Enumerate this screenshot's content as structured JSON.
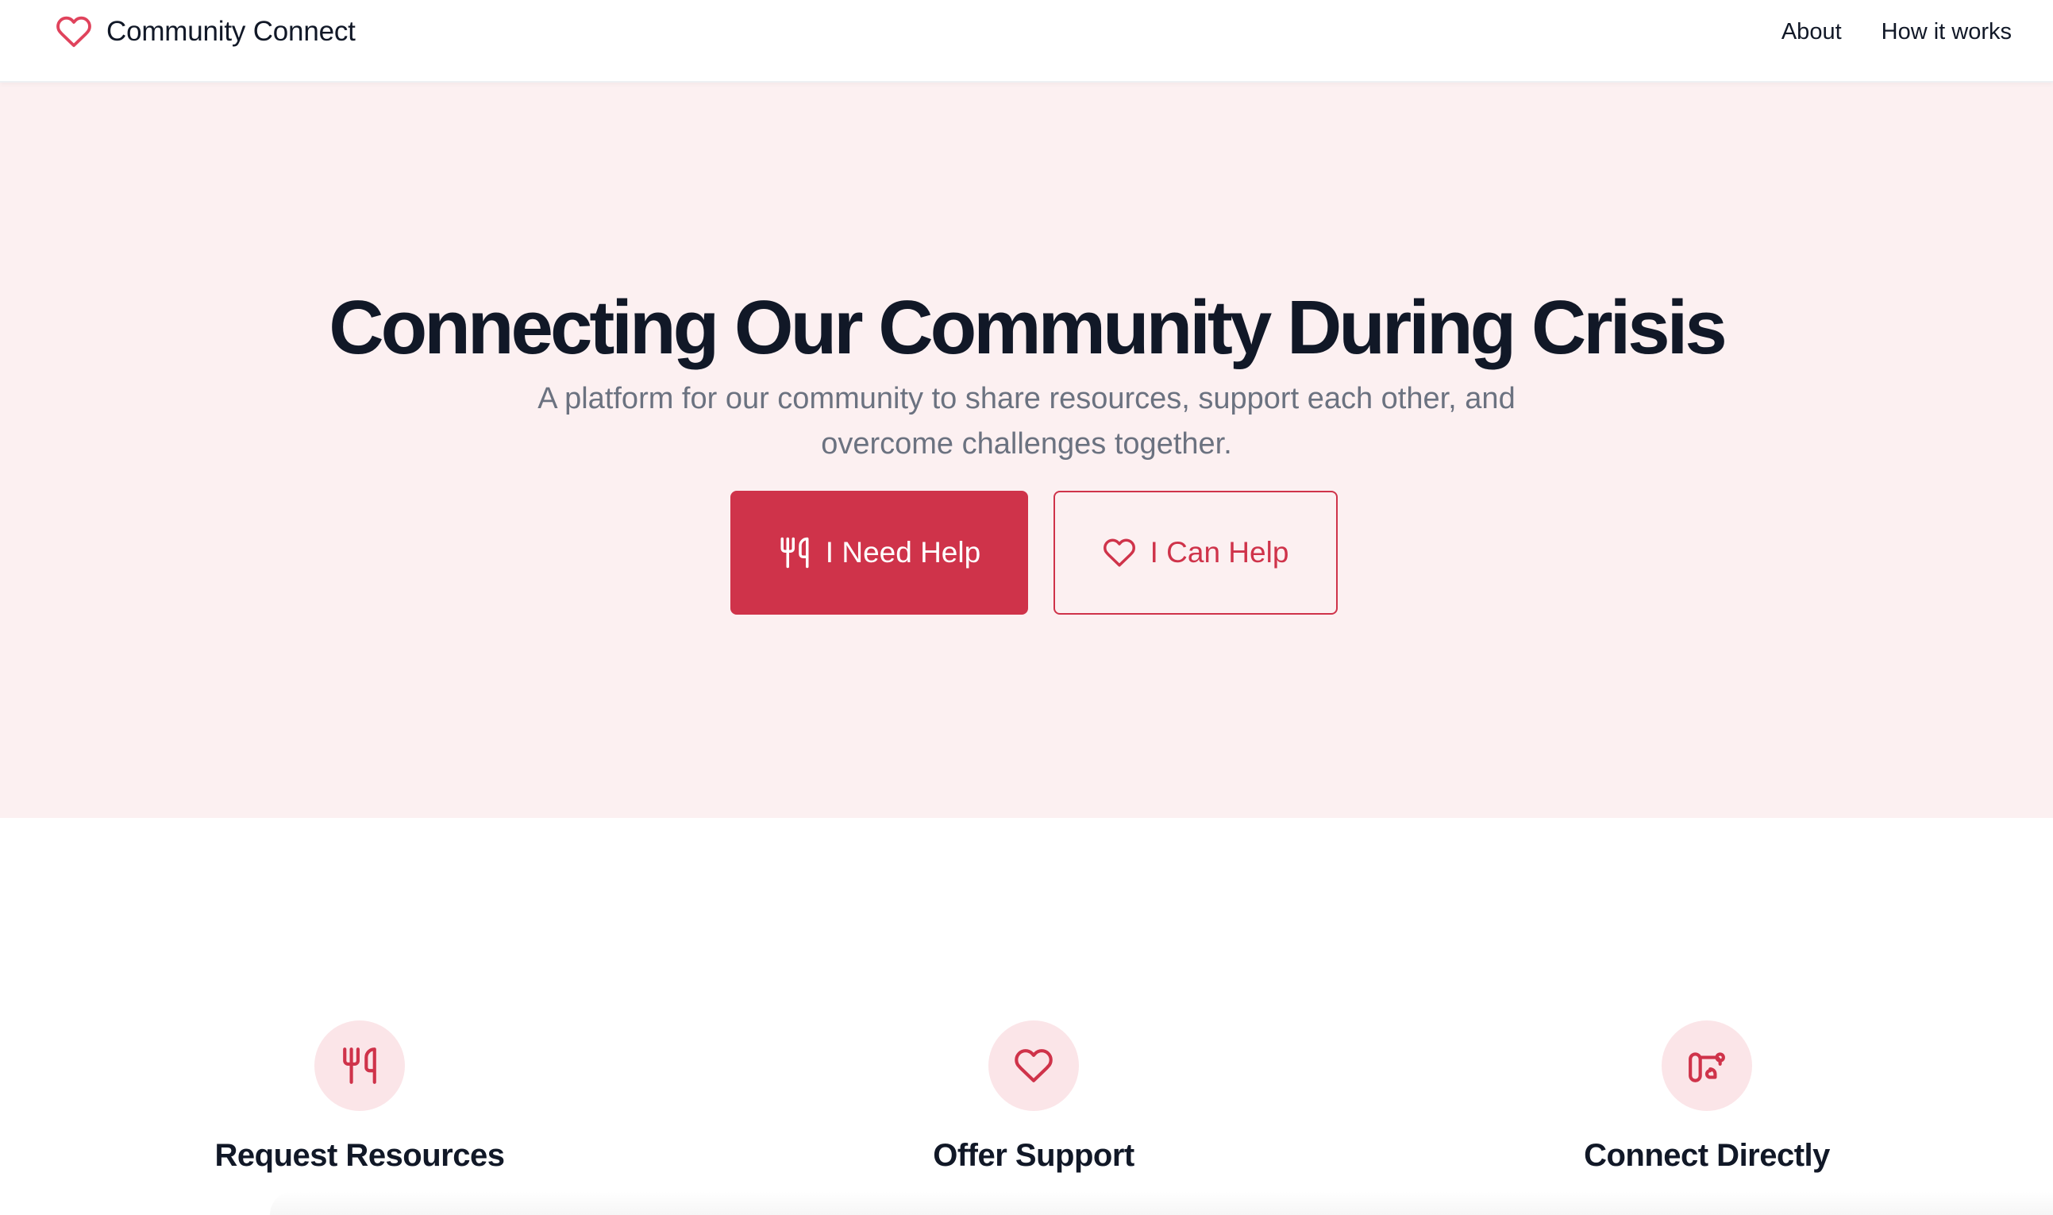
{
  "nav": {
    "brand_name": "Community Connect",
    "brand_icon": "heart-icon",
    "links": [
      {
        "label": "About"
      },
      {
        "label": "How it works"
      }
    ]
  },
  "hero": {
    "title": "Connecting Our Community During Crisis",
    "subtitle": "A platform for our community to share resources, support each other, and overcome challenges together.",
    "primary_button": {
      "label": "I Need Help",
      "icon": "utensils-icon"
    },
    "secondary_button": {
      "label": "I Can Help",
      "icon": "heart-icon"
    }
  },
  "features": [
    {
      "title": "Request Resources",
      "icon": "utensils-icon"
    },
    {
      "title": "Offer Support",
      "icon": "heart-icon"
    },
    {
      "title": "Connect Directly",
      "icon": "phone-connect-icon"
    }
  ],
  "colors": {
    "accent": "#cf334a",
    "hero_background": "#fcf0f1",
    "icon_circle": "#fbe5e8",
    "heading": "#111827",
    "muted_text": "#6b7280"
  }
}
